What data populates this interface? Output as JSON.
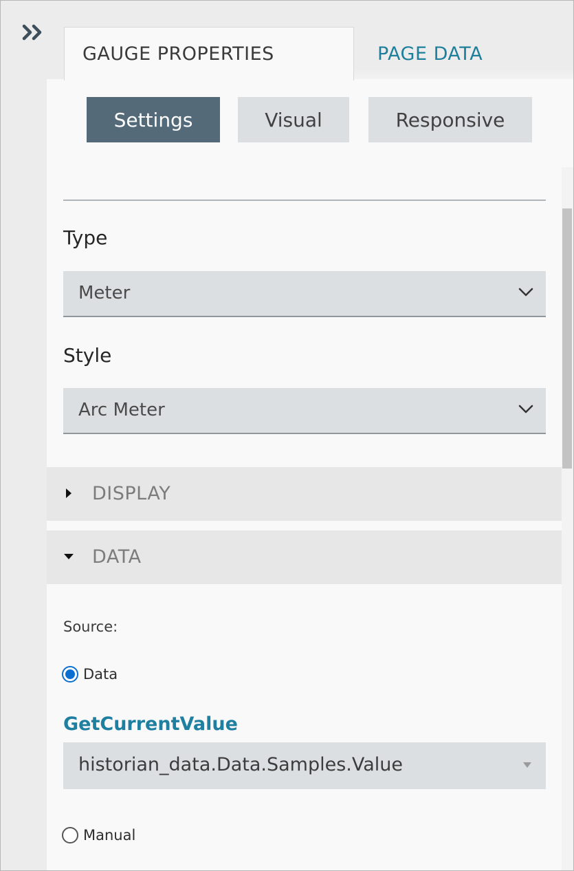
{
  "tabs": {
    "gauge_properties": "GAUGE PROPERTIES",
    "page_data": "PAGE DATA"
  },
  "subtabs": {
    "settings": "Settings",
    "visual": "Visual",
    "responsive": "Responsive"
  },
  "type_field": {
    "label": "Type",
    "value": "Meter"
  },
  "style_field": {
    "label": "Style",
    "value": "Arc Meter"
  },
  "sections": {
    "display": {
      "title": "DISPLAY",
      "expanded": false
    },
    "data": {
      "title": "DATA",
      "expanded": true
    }
  },
  "data_section": {
    "source_label": "Source:",
    "options": {
      "data": {
        "label": "Data",
        "selected": true
      },
      "manual": {
        "label": "Manual",
        "selected": false
      }
    },
    "query_link": "GetCurrentValue",
    "query_value": "historian_data.Data.Samples.Value"
  },
  "colors": {
    "active_subtab": "#546a79",
    "link": "#1f7fa1",
    "radio_selected": "#0b6fd1",
    "section_header": "#e7e7e7"
  }
}
